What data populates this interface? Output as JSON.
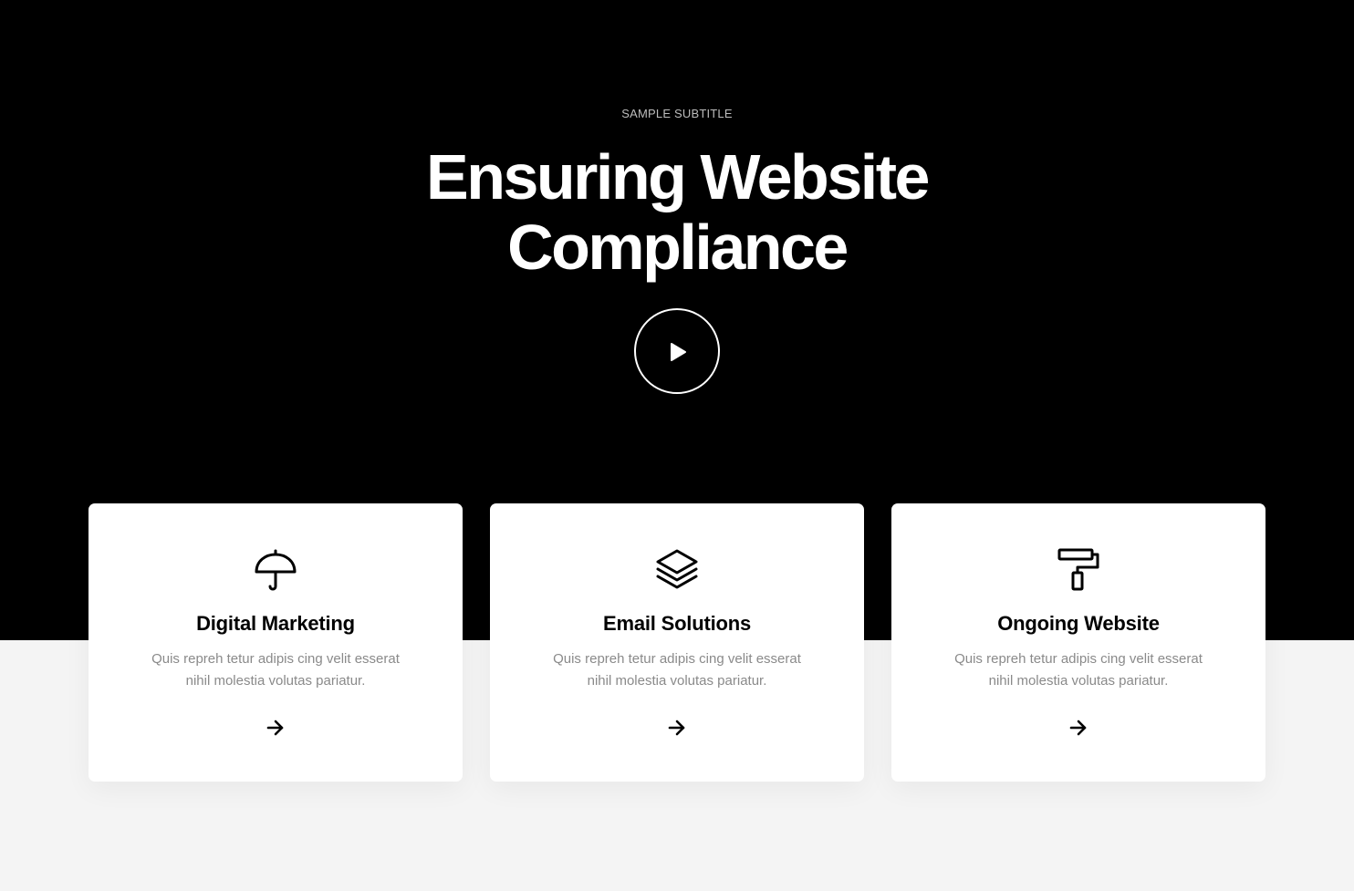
{
  "hero": {
    "subtitle": "SAMPLE SUBTITLE",
    "title_line1": "Ensuring Website",
    "title_line2": "Compliance",
    "play_icon": "play-icon",
    "background": "#000000"
  },
  "cards": [
    {
      "icon": "umbrella-icon",
      "title": "Digital Marketing",
      "desc_line1": "Quis repreh tetur adipis cing velit esserat",
      "desc_line2": "nihil molestia volutas pariatur.",
      "link_icon": "arrow-right-icon"
    },
    {
      "icon": "layers-icon",
      "title": "Email Solutions",
      "desc_line1": "Quis repreh tetur adipis cing velit esserat",
      "desc_line2": "nihil molestia volutas pariatur.",
      "link_icon": "arrow-right-icon"
    },
    {
      "icon": "paint-roller-icon",
      "title": "Ongoing Website",
      "desc_line1": "Quis repreh tetur adipis cing velit esserat",
      "desc_line2": "nihil molestia volutas pariatur.",
      "link_icon": "arrow-right-icon"
    }
  ],
  "colors": {
    "hero_bg": "#000000",
    "page_bg": "#f4f4f4",
    "card_bg": "#ffffff",
    "text_muted": "#8a8a8a"
  }
}
